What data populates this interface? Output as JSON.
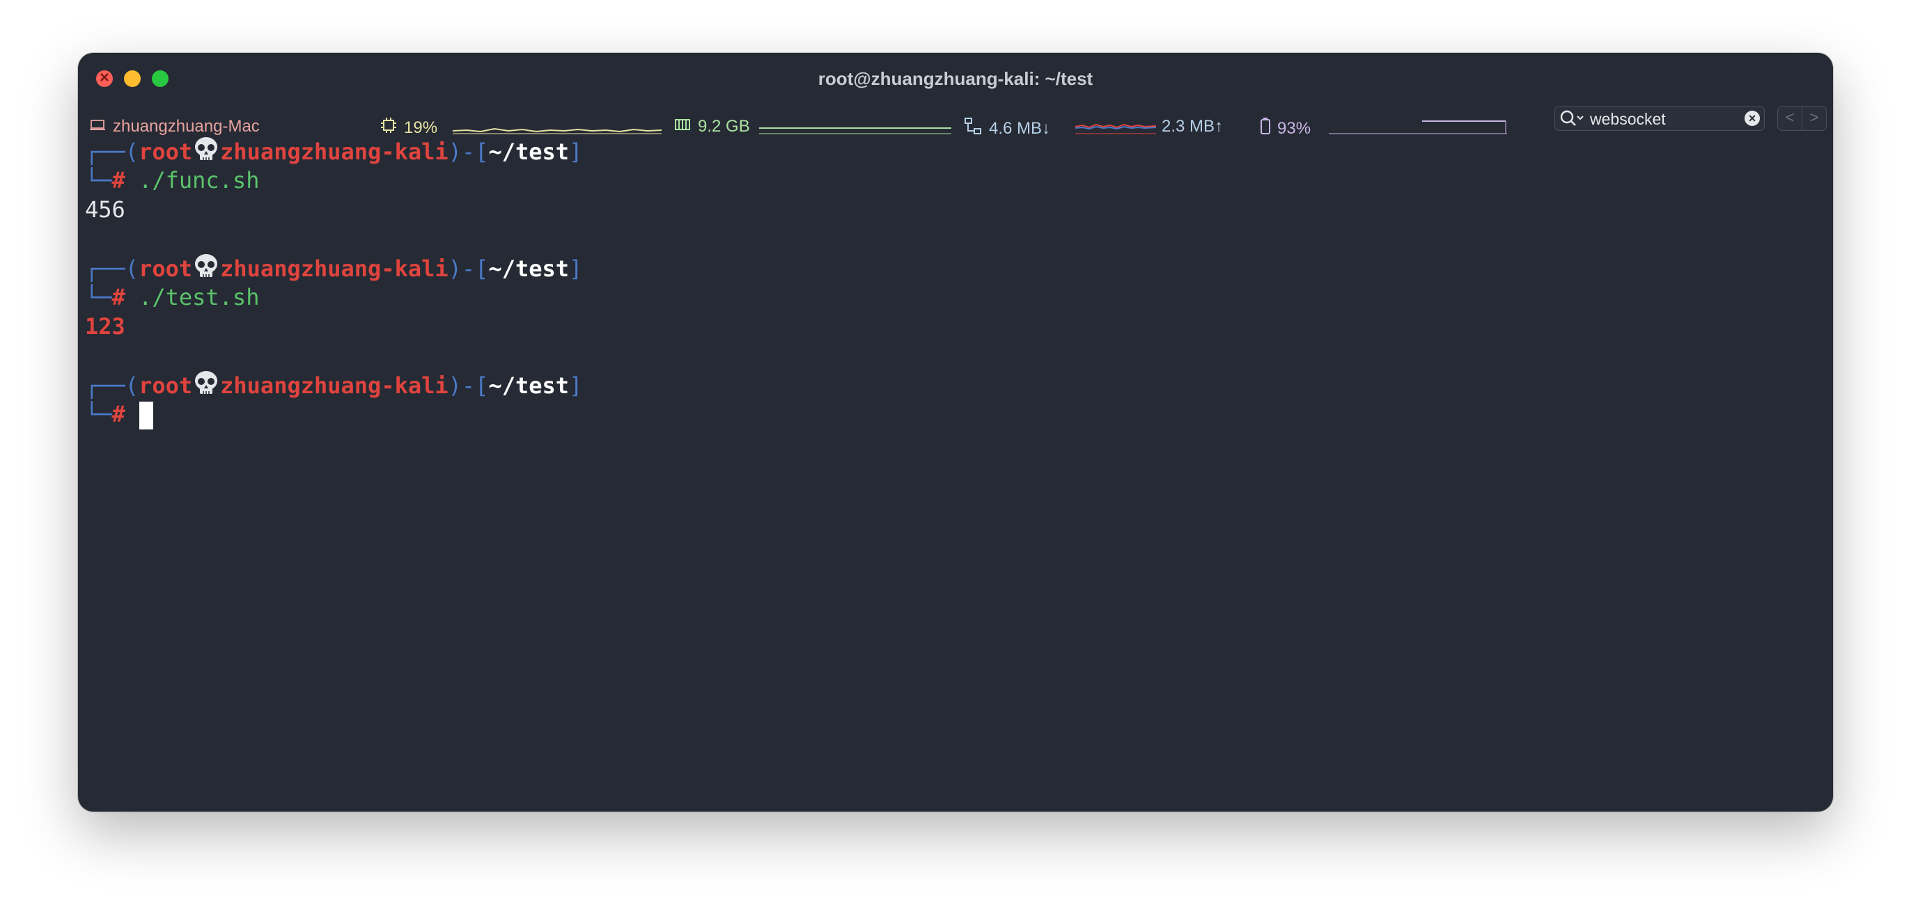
{
  "window": {
    "title": "root@zhuangzhuang-kali: ~/test"
  },
  "statusbar": {
    "host": "zhuangzhuang-Mac",
    "cpu": "19%",
    "memory": "9.2 GB",
    "net_down": "4.6 MB↓",
    "net_up": "2.3 MB↑",
    "battery": "93%"
  },
  "search": {
    "value": "websocket",
    "prev": "<",
    "next": ">"
  },
  "terminal": {
    "prompt_user": "root",
    "prompt_host": "zhuangzhuang-kali",
    "prompt_path": "~/test",
    "prompt_symbol": "#",
    "blocks": [
      {
        "command": "./func.sh",
        "output": "456"
      },
      {
        "command": "./test.sh",
        "output": "123"
      },
      {
        "command": "",
        "output": ""
      }
    ]
  },
  "colors": {
    "background": "#262a34",
    "prompt_red": "#e0443e",
    "prompt_blue": "#4a7ac8",
    "command_green": "#5ac36b"
  }
}
